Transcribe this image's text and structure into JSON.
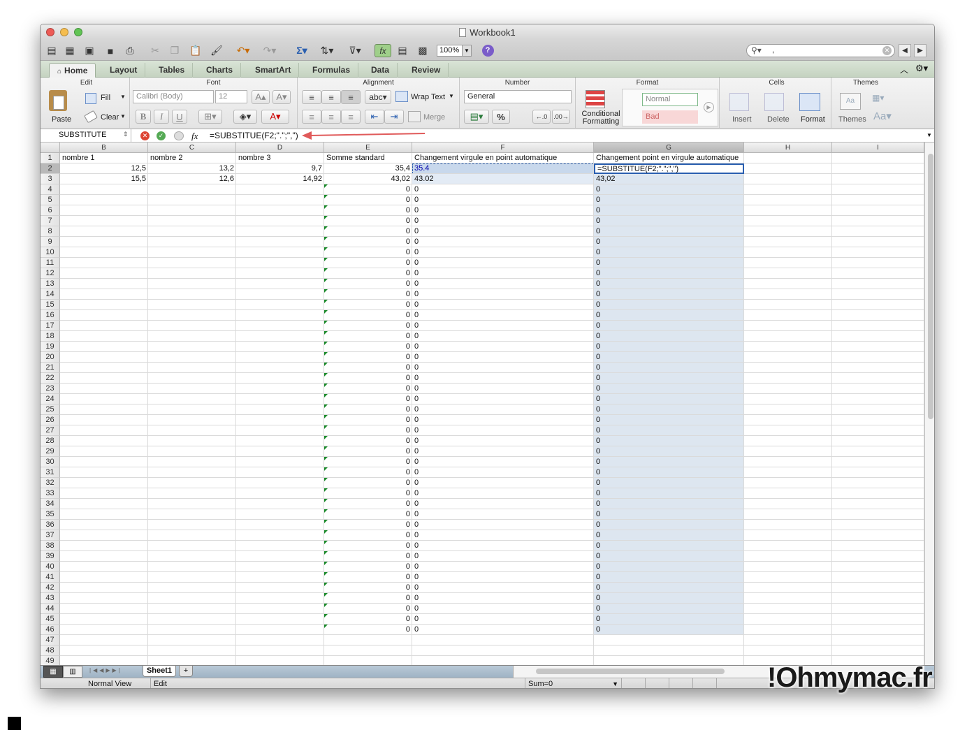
{
  "window": {
    "title": "Workbook1"
  },
  "toolbar": {
    "zoom": "100%",
    "search_value": ","
  },
  "tabs": [
    "Home",
    "Layout",
    "Tables",
    "Charts",
    "SmartArt",
    "Formulas",
    "Data",
    "Review"
  ],
  "ribbon": {
    "edit": {
      "name": "Edit",
      "paste": "Paste",
      "fill": "Fill",
      "clear": "Clear"
    },
    "font": {
      "name": "Font",
      "family": "Calibri (Body)",
      "size": "12"
    },
    "alignment": {
      "name": "Alignment",
      "wrap": "Wrap Text",
      "merge": "Merge",
      "abc": "abc"
    },
    "number": {
      "name": "Number",
      "format": "General"
    },
    "format": {
      "name": "Format",
      "normal": "Normal",
      "bad": "Bad",
      "conditional": "Conditional Formatting"
    },
    "cells": {
      "name": "Cells",
      "insert": "Insert",
      "delete": "Delete",
      "format": "Format"
    },
    "themes": {
      "name": "Themes",
      "themes": "Themes"
    }
  },
  "formula_bar": {
    "name_box": "SUBSTITUTE",
    "fx": "fx",
    "formula": "=SUBSTITUE(F2;\".\";\",\")"
  },
  "columns": [
    "B",
    "C",
    "D",
    "E",
    "F",
    "G",
    "H",
    "I"
  ],
  "rows": [
    "1",
    "2",
    "3",
    "4",
    "5",
    "6",
    "7",
    "8",
    "9",
    "10",
    "11",
    "12",
    "13",
    "14",
    "15",
    "16",
    "17",
    "18",
    "19",
    "20",
    "21",
    "22",
    "23",
    "24",
    "25",
    "26",
    "27",
    "28",
    "29",
    "30",
    "31",
    "32",
    "33",
    "34",
    "35",
    "36",
    "37",
    "38",
    "39",
    "40",
    "41",
    "42",
    "43",
    "44",
    "45",
    "46",
    "47",
    "48",
    "49"
  ],
  "sheet": {
    "headers": {
      "B": "nombre 1",
      "C": "nombre 2",
      "D": "nombre 3",
      "E": "Somme standard",
      "F": "Changement virgule en point automatique",
      "G": "Changement point en virgule automatique"
    },
    "row2": {
      "B": "12,5",
      "C": "13,2",
      "D": "9,7",
      "E": "35,4",
      "F": "35.4",
      "G": "=SUBSTITUE(F2;\".\";\",\")"
    },
    "row3": {
      "B": "15,5",
      "C": "12,6",
      "D": "14,92",
      "E": "43,02",
      "F": "43.02",
      "G": "43,02"
    },
    "zero_value": "0",
    "zero_rows_from": 4,
    "zero_rows_to": 46
  },
  "sheet_tabs": [
    "Sheet1"
  ],
  "add_sheet": "+",
  "status": {
    "view": "Normal View",
    "mode": "Edit",
    "sum": "Sum=0"
  },
  "watermark": "!Ohmymac.fr"
}
